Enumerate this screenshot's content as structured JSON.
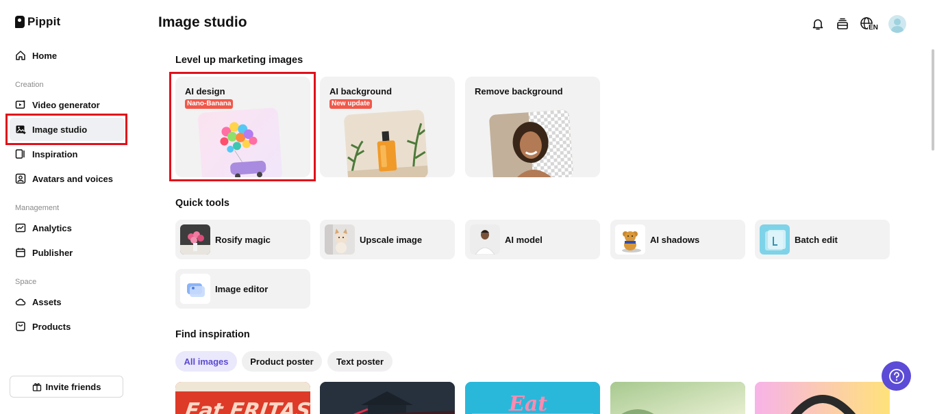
{
  "app": {
    "logo_text": "Pippit"
  },
  "sidebar": {
    "home": "Home",
    "creation_label": "Creation",
    "creation_items": [
      "Video generator",
      "Image studio",
      "Inspiration",
      "Avatars and voices"
    ],
    "management_label": "Management",
    "management_items": [
      "Analytics",
      "Publisher"
    ],
    "space_label": "Space",
    "space_items": [
      "Assets",
      "Products"
    ],
    "invite_label": "Invite friends",
    "active_item": "Image studio"
  },
  "header": {
    "title": "Image studio",
    "language_code": "EN",
    "icons": [
      "bell-icon",
      "credits-icon",
      "globe-icon",
      "avatar"
    ]
  },
  "marketing": {
    "heading": "Level up marketing images",
    "cards": [
      {
        "title": "AI design",
        "badge": "Nano-Banana"
      },
      {
        "title": "AI background",
        "badge": "New update"
      },
      {
        "title": "Remove background",
        "badge": ""
      }
    ]
  },
  "quick_tools": {
    "heading": "Quick tools",
    "items": [
      "Rosify magic",
      "Upscale image",
      "AI model",
      "AI shadows",
      "Batch edit",
      "Image editor"
    ]
  },
  "inspiration": {
    "heading": "Find inspiration",
    "filters": [
      "All images",
      "Product poster",
      "Text poster"
    ],
    "active_filter": "All images"
  },
  "colors": {
    "accent": "#5b4bd6",
    "highlight_border": "#e0101a",
    "badge": "#f0584a",
    "card_bg": "#f2f2f2"
  }
}
